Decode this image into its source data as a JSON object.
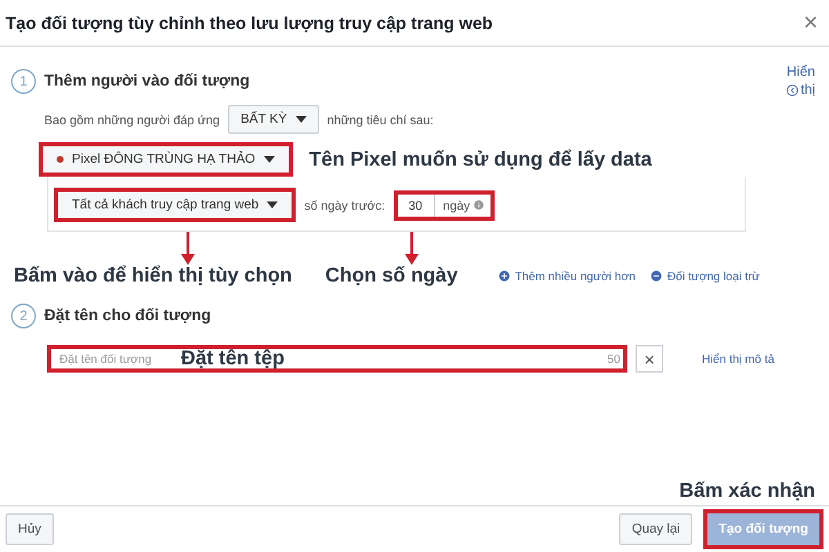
{
  "dialog": {
    "title": "Tạo đối tượng tùy chỉnh theo lưu lượng truy cập trang web",
    "close": "×"
  },
  "section1": {
    "number": "1",
    "title": "Thêm người vào đối tượng",
    "toggle": [
      "Hiển",
      "thị"
    ],
    "criteria": {
      "prefix": "Bao gồm những người đáp ứng",
      "choice": "BẤT KỲ",
      "suffix": "những tiêu chí sau:"
    },
    "pixel": {
      "label": "Pixel ĐÔNG TRÙNG HẠ THẢO",
      "color": "#c0392b",
      "note": "Tên Pixel muốn sử dụng để lấy data"
    },
    "rule": {
      "visitors": "Tất cả khách truy cập trang web",
      "days_label": "số ngày trước:",
      "days": "30",
      "unit": "ngày"
    },
    "notes": [
      "Bấm vào để hiển thị tùy chọn",
      "Chọn số ngày"
    ],
    "links": [
      {
        "kind": "add",
        "label": "Thêm nhiều người hơn"
      },
      {
        "kind": "exclude",
        "label": "Đối tượng loại trừ"
      }
    ]
  },
  "section2": {
    "number": "2",
    "title": "Đặt tên cho đối tượng",
    "placeholder": "Đặt tên đối tượng",
    "note": "Đặt tên tệp",
    "counter": "50",
    "clear": "×",
    "link": "Hiển thị mô tả"
  },
  "confirm_note": "Bấm xác nhận",
  "footer": {
    "cancel": "Hủy",
    "back": "Quay lại",
    "create": {
      "label": "Tạo đối tượng",
      "disabled": true
    }
  }
}
